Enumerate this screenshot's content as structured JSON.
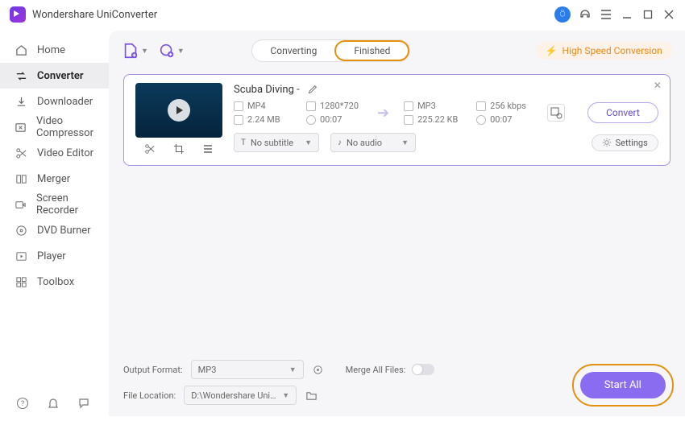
{
  "app": {
    "title": "Wondershare UniConverter"
  },
  "titlebar": {
    "avatar_glyph": "⍥"
  },
  "sidebar": {
    "items": [
      {
        "label": "Home"
      },
      {
        "label": "Converter"
      },
      {
        "label": "Downloader"
      },
      {
        "label": "Video Compressor"
      },
      {
        "label": "Video Editor"
      },
      {
        "label": "Merger"
      },
      {
        "label": "Screen Recorder"
      },
      {
        "label": "DVD Burner"
      },
      {
        "label": "Player"
      },
      {
        "label": "Toolbox"
      }
    ]
  },
  "toolbar": {
    "tabs": {
      "converting": "Converting",
      "finished": "Finished"
    },
    "hsc": "High Speed Conversion"
  },
  "file": {
    "title": "Scuba Diving -",
    "source": {
      "fmt": "MP4",
      "res": "1280*720",
      "size": "2.24 MB",
      "dur": "00:07"
    },
    "target": {
      "fmt": "MP3",
      "bitrate": "256 kbps",
      "size": "225.22 KB",
      "dur": "00:07"
    },
    "subtitle_sel": "No subtitle",
    "audio_sel": "No audio",
    "settings_label": "Settings",
    "convert_label": "Convert"
  },
  "footer": {
    "output_label": "Output Format:",
    "output_value": "MP3",
    "location_label": "File Location:",
    "location_value": "D:\\Wondershare UniConverter",
    "merge_label": "Merge All Files:",
    "start_label": "Start All"
  }
}
